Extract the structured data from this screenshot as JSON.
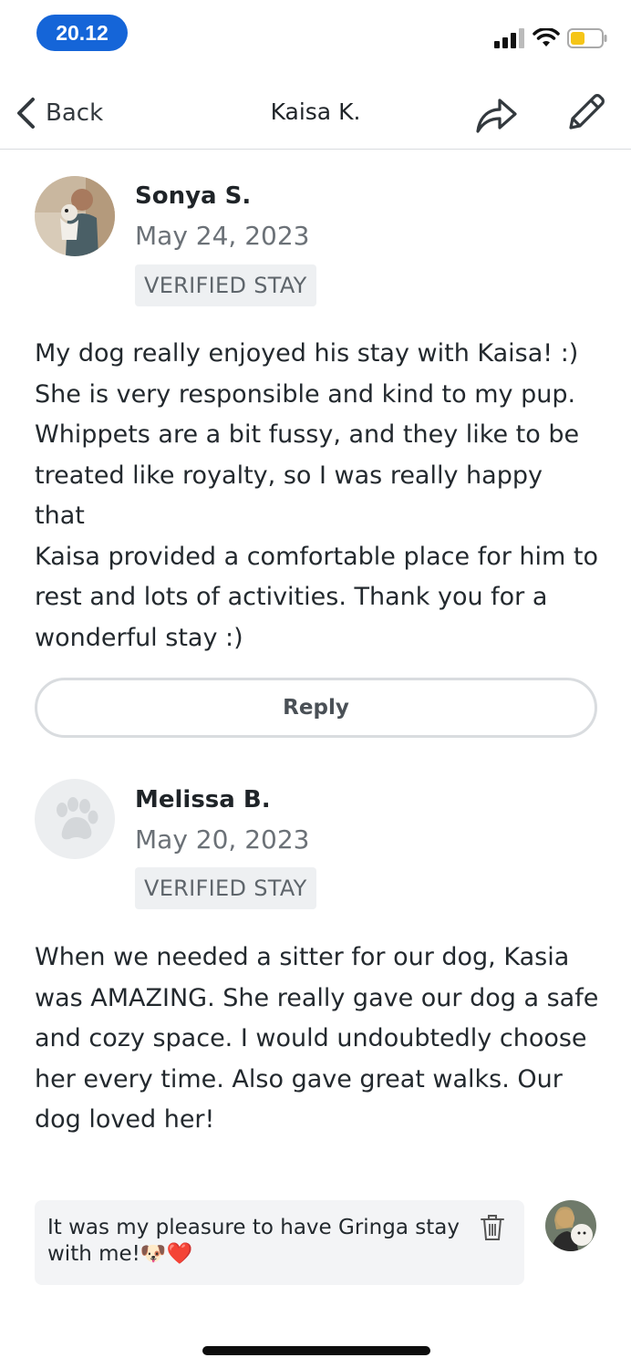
{
  "status_bar": {
    "time": "20.12"
  },
  "nav": {
    "back_label": "Back",
    "title": "Kaisa K.",
    "share_icon": "share-arrow-icon",
    "edit_icon": "pencil-icon"
  },
  "reviews": [
    {
      "name": "Sonya S.",
      "date": "May 24, 2023",
      "badge": "VERIFIED STAY",
      "body_lines": [
        "My dog really enjoyed his stay with Kaisa! :)",
        "She is very responsible and kind to my pup.",
        "Whippets are a bit fussy, and they like to be",
        "treated like royalty, so I was really happy that",
        "Kaisa provided a comfortable place for him to",
        "rest and lots of activities. Thank you for a",
        "wonderful stay :)"
      ]
    },
    {
      "name": "Melissa B.",
      "date": "May 20, 2023",
      "badge": "VERIFIED STAY",
      "avatar_icon": "paw-icon",
      "body_lines": [
        "When we needed a sitter for our dog, Kasia",
        "was AMAZING. She really gave our dog a safe",
        "and cozy space. I would undoubtedly choose",
        "her every time. Also gave great walks. Our",
        "dog loved her!"
      ]
    }
  ],
  "reply_button_label": "Reply",
  "owner_reply": {
    "line1": "It was my pleasure to have Gringa stay",
    "line2": "with me!🐶❤️"
  },
  "colors": {
    "accent": "#1565d8",
    "battery_fill": "#f5c518"
  }
}
